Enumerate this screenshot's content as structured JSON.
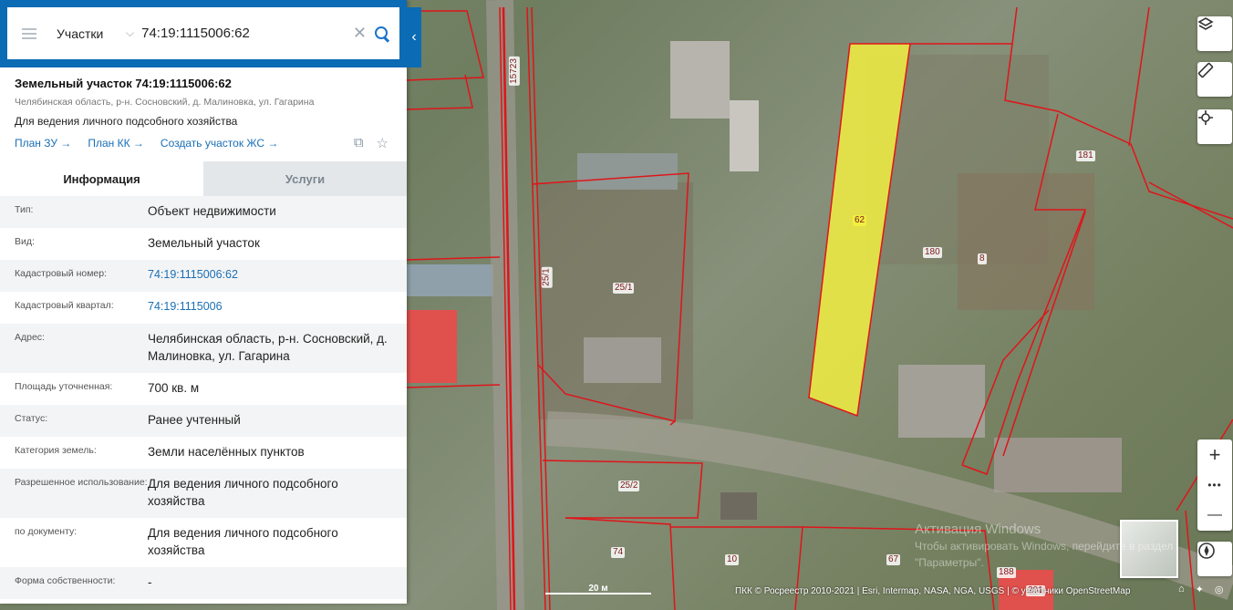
{
  "search": {
    "category": "Участки",
    "value": "74:19:1115006:62"
  },
  "parcel": {
    "title": "Земельный участок 74:19:1115006:62",
    "address_short": "Челябинская область, р-н. Сосновский, д. Малиновка, ул. Гагарина",
    "purpose": "Для ведения личного подсобного хозяйства",
    "links": [
      "План ЗУ →",
      "План КК →",
      "Создать участок ЖС →"
    ]
  },
  "tabs": [
    "Информация",
    "Услуги"
  ],
  "info_rows": [
    {
      "key": "Тип:",
      "value": "Объект недвижимости"
    },
    {
      "key": "Вид:",
      "value": "Земельный участок"
    },
    {
      "key": "Кадастровый номер:",
      "value": "74:19:1115006:62"
    },
    {
      "key": "Кадастровый квартал:",
      "value": "74:19:1115006"
    },
    {
      "key": "Адрес:",
      "value": "Челябинская область, р-н. Сосновский, д. Малиновка, ул. Гагарина"
    },
    {
      "key": "Площадь уточненная:",
      "value": "700 кв. м"
    },
    {
      "key": "Статус:",
      "value": "Ранее учтенный"
    },
    {
      "key": "Категория земель:",
      "value": "Земли населённых пунктов"
    },
    {
      "key": "Разрешенное использование:",
      "value": "Для ведения личного подсобного хозяйства"
    },
    {
      "key": "по документу:",
      "value": "Для ведения личного подсобного хозяйства"
    },
    {
      "key": "Форма собственности:",
      "value": "-"
    }
  ],
  "map": {
    "labels": [
      "15723",
      "25/1",
      "25/1",
      "62",
      "180",
      "8",
      "181",
      "25/2",
      "74",
      "10",
      "67",
      "188",
      "201"
    ],
    "scale": "20 м",
    "attribution": "ПКК © Росреестр 2010-2021 | Esri, Intermap, NASA, NGA, USGS | © участники OpenStreetMap",
    "watermark_title": "Активация Windows",
    "watermark_sub": "Чтобы активировать Windows, перейдите в раздел \"Параметры\".",
    "zoom_in": "+",
    "zoom_more": "•••",
    "zoom_out": "—"
  },
  "colors": {
    "brand": "#0b6bb4",
    "link": "#1a6fb5",
    "boundary": "#e0141a",
    "selected_fill": "#f2ee42"
  }
}
